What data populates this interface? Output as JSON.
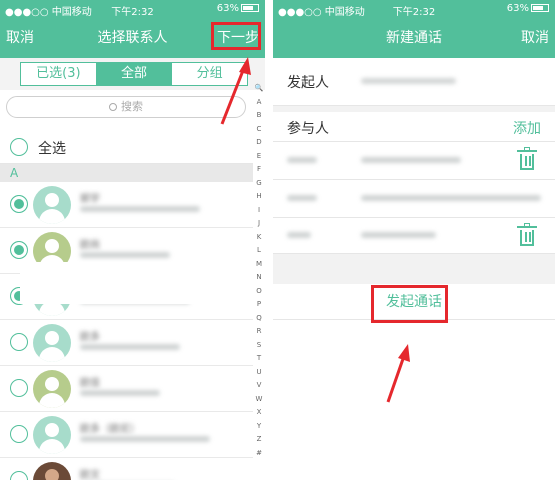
{
  "left_screen": {
    "status": {
      "carrier": "●●●○○ 中国移动",
      "time": "下午2:32",
      "battery": "63%"
    },
    "nav": {
      "cancel": "取消",
      "title": "选择联系人",
      "next": "下一步"
    },
    "segments": [
      {
        "label": "已选(3)",
        "active": false
      },
      {
        "label": "全部",
        "active": true
      },
      {
        "label": "分组",
        "active": false
      }
    ],
    "search": {
      "placeholder": "搜索"
    },
    "select_all": "全选",
    "section_header": "A",
    "contacts": [
      {
        "name": "郭宇",
        "checked": true,
        "avatar": "teal"
      },
      {
        "name": "欧尚",
        "checked": true,
        "avatar": "olive"
      },
      {
        "name": "",
        "checked": true,
        "avatar": "teal"
      },
      {
        "name": "欧多",
        "checked": false,
        "avatar": "teal"
      },
      {
        "name": "欧佳",
        "checked": false,
        "avatar": "olive"
      },
      {
        "name": "欧多（欧尼）",
        "checked": false,
        "avatar": "teal"
      },
      {
        "name": "欧文",
        "checked": false,
        "avatar": "photo"
      }
    ],
    "index_letters": [
      "🔍",
      "A",
      "B",
      "C",
      "D",
      "E",
      "F",
      "G",
      "H",
      "I",
      "J",
      "K",
      "L",
      "M",
      "N",
      "O",
      "P",
      "Q",
      "R",
      "S",
      "T",
      "U",
      "V",
      "W",
      "X",
      "Y",
      "Z",
      "#"
    ]
  },
  "right_screen": {
    "status": {
      "carrier": "●●●○○ 中国移动",
      "time": "下午2:32",
      "battery": "63%"
    },
    "nav": {
      "title": "新建通话",
      "cancel": "取消"
    },
    "initiator_label": "发起人",
    "participants_label": "参与人",
    "add_label": "添加",
    "start_call": "发起通话"
  },
  "colors": {
    "accent": "#52bf9b",
    "highlight_box": "#e5282d"
  }
}
